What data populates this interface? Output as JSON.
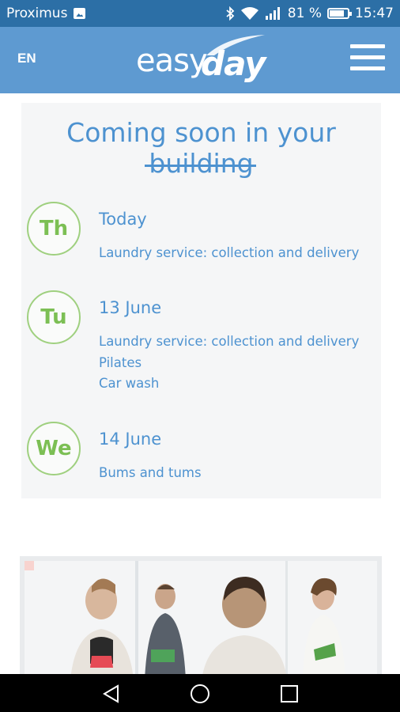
{
  "status_bar": {
    "carrier": "Proximus",
    "battery_percent": "81 %",
    "battery_level": 0.81,
    "time": "15:47",
    "icons": [
      "image-notification-icon",
      "bluetooth-icon",
      "wifi-icon",
      "signal-icon",
      "battery-icon"
    ]
  },
  "header": {
    "language": "EN",
    "logo_part1": "easy",
    "logo_part2": "day",
    "menu_icon": "hamburger-menu-icon",
    "background": "#5e9ad1"
  },
  "schedule": {
    "title": "Coming soon in your building",
    "accent": "#4d92d0",
    "day_color": "#7cbf54",
    "events": [
      {
        "day": "Th",
        "date": "Today",
        "items": [
          "Laundry service: collection and delivery"
        ]
      },
      {
        "day": "Tu",
        "date": "13 June",
        "items": [
          "Laundry service: collection and delivery",
          "Pilates",
          "Car wash"
        ]
      },
      {
        "day": "We",
        "date": "14 June",
        "items": [
          "Bums and tums"
        ]
      }
    ]
  },
  "nav_bar": {
    "icons": [
      "back-icon",
      "home-icon",
      "recents-icon"
    ]
  }
}
